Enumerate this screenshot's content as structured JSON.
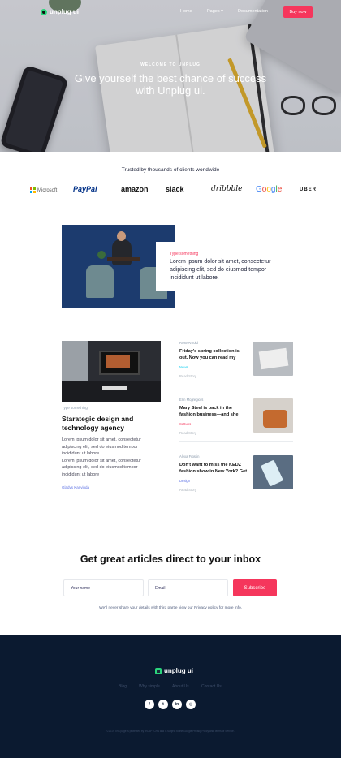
{
  "nav": {
    "logo": "unplug ui",
    "links": [
      "Home",
      "Pages",
      "Documentation"
    ],
    "pages_caret": "▾",
    "cta": "Buy now"
  },
  "hero": {
    "eyebrow": "WELCOME TO UNPLUG",
    "title": "Give yourself the best chance of success with Unplug ui."
  },
  "trusted": {
    "title": "Trusted by thousands of clients worldwide",
    "brands": {
      "microsoft": "Microsoft",
      "paypal": "PayPal",
      "amazon": "amazon",
      "slack": "slack",
      "dribbble": "dribbble",
      "google": [
        "G",
        "o",
        "o",
        "g",
        "l",
        "e"
      ],
      "uber": "UBER"
    }
  },
  "feature": {
    "tag": "Type something",
    "title": "Lorem ipsum dolor sit amet, consectetur adipiscing elit, sed do eiusmod tempor incididunt ut labore."
  },
  "main_article": {
    "tag": "Type something",
    "title": "Starategic design and technology agency",
    "body_1": "Lorem ipsum dolor sit amet, consectetur adipiscing elit, sed do eiusmod tempor incididunt ut labore",
    "body_2": "Lorem ipsum dolor sit amet, consectetur adipiscing elit, sed do eiusmod tempor incididunt ut labore",
    "author": "Gladys Kanyinda"
  },
  "side_articles": [
    {
      "tag": "Rose Arnold",
      "title": "Friday's spring collection is out. Now you can read my",
      "category": "News",
      "category_color": "#11cdef",
      "read": "Read Story"
    },
    {
      "tag": "Erin Mcgregiors",
      "title": "Mary Steel is back in the fashion business—and she",
      "category": "Settups",
      "category_color": "#f5365c",
      "read": "Read Story"
    },
    {
      "tag": "Alexa Frostin",
      "title": "Don't want to miss the KEDZ fashion show in New York? Get",
      "category": "Design",
      "category_color": "#5e72e4",
      "read": "Read Story"
    }
  ],
  "subscribe": {
    "title": "Get great articles direct to your inbox",
    "name_placeholder": "Your name",
    "email_placeholder": "Email",
    "button": "Subscribe",
    "note": "We'll never share your details with third partie view our Privacy policy for more info."
  },
  "footer": {
    "logo": "unplug ui",
    "links": [
      "Blog",
      "Why simple",
      "About Us",
      "Contact Us"
    ],
    "socials": [
      "f",
      "t",
      "in",
      "◎"
    ],
    "copyright": "©2019 This page is protected by reCAPTCHA and is subject to the Google Privacy Policy and Terms of Service."
  },
  "colors": {
    "accent": "#f5365c",
    "footer_bg": "#0b1a30",
    "link_blue": "#5e72e4",
    "logo_green": "#2bd57c"
  }
}
